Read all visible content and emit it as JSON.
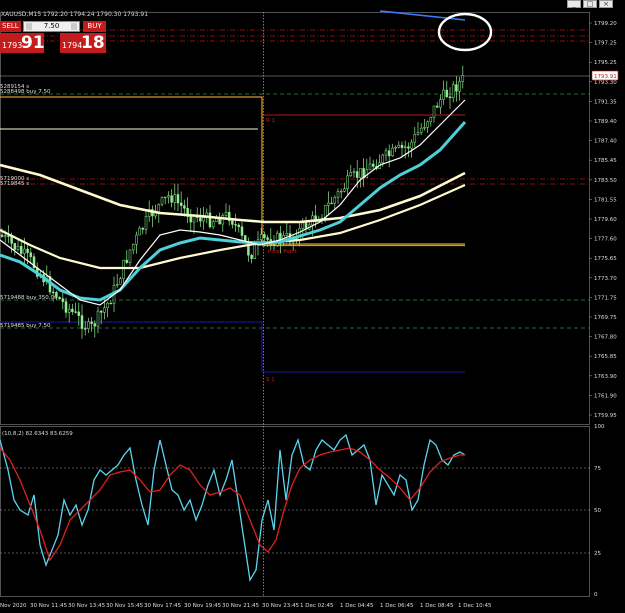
{
  "window": {
    "title": "XAUUSD,M15  1792.20 1794.24 1790.30 1793.91",
    "buttons": [
      "_",
      "□",
      "×"
    ]
  },
  "trade_panel": {
    "sell_label": "SELL",
    "buy_label": "BUY",
    "lot_value": "7.50",
    "sell_price_small": "1793",
    "sell_price_big": "91",
    "buy_price_small": "1794",
    "buy_price_big": "18"
  },
  "price_axis": {
    "ticks": [
      "1799.20",
      "1797.25",
      "1795.25",
      "1793.30",
      "1791.35",
      "1789.40",
      "1787.40",
      "1785.45",
      "1783.50",
      "1781.55",
      "1779.60",
      "1777.60",
      "1775.65",
      "1773.70",
      "1771.75",
      "1769.75",
      "1767.80",
      "1765.85",
      "1763.90",
      "1761.90",
      "1759.95"
    ],
    "current_price": "1793.91"
  },
  "indicator": {
    "label": "(10,8,2) 82.6343 83.6259",
    "levels": [
      "100",
      "75",
      "50",
      "25",
      "0"
    ]
  },
  "time_axis": {
    "labels": [
      "Nov 2020",
      "30 Nov 11:45",
      "30 Nov 13:45",
      "30 Nov 15:45",
      "30 Nov 17:45",
      "30 Nov 19:45",
      "30 Nov 21:45",
      "30 Nov 23:45",
      "1 Dec 02:45",
      "1 Dec 04:45",
      "1 Dec 06:45",
      "1 Dec 08:45",
      "1 Dec 10:45"
    ]
  },
  "chart_labels": {
    "r1": "R 1",
    "s1": "S 1",
    "pivot": "Pivot Point",
    "order_lines": [
      "5289154 s",
      "5288498 buy 7.50",
      "5719000 s",
      "5719845 s",
      "5719488 buy 350.00",
      "5719485 buy 7.50"
    ]
  },
  "colors": {
    "background": "#000000",
    "candle": "#90ee90",
    "ma_fast": "#ffffff",
    "ma_mid": "#4dd0d8",
    "ma_slow": "#fffacd",
    "stoch_main": "#5bd5f0",
    "stoch_signal": "#e02020",
    "pivot": "#d49a2a",
    "resistance": "#b01818",
    "support": "#1a1aa8",
    "annotation": "#ffffff"
  }
}
